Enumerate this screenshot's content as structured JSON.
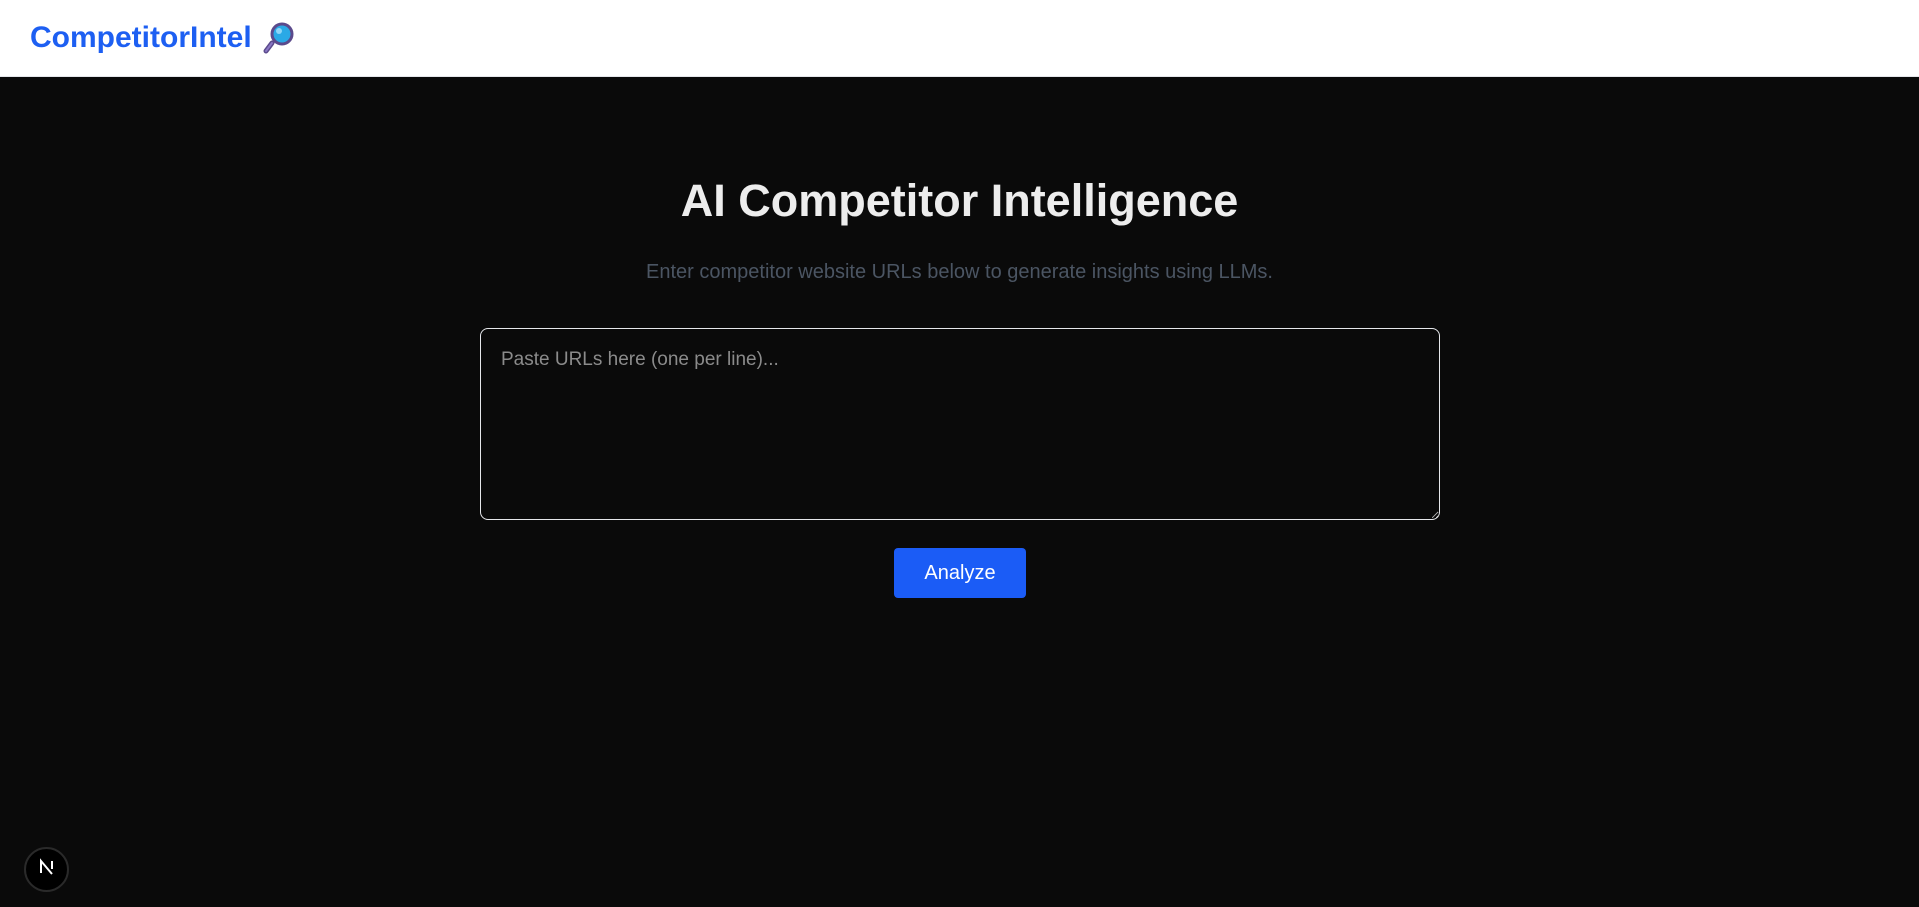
{
  "navbar": {
    "brand_text": "CompetitorIntel",
    "brand_icon": "magnifying-glass-icon",
    "brand_color": "#1d5ff2"
  },
  "hero": {
    "title": "AI Competitor Intelligence",
    "subtitle": "Enter competitor website URLs below to generate insights using LLMs."
  },
  "form": {
    "url_input_value": "",
    "url_input_placeholder": "Paste URLs here (one per line)...",
    "analyze_label": "Analyze",
    "analyze_color": "#1b5cf6"
  },
  "dev_indicator": {
    "icon": "nextjs-icon",
    "letter": "N"
  }
}
